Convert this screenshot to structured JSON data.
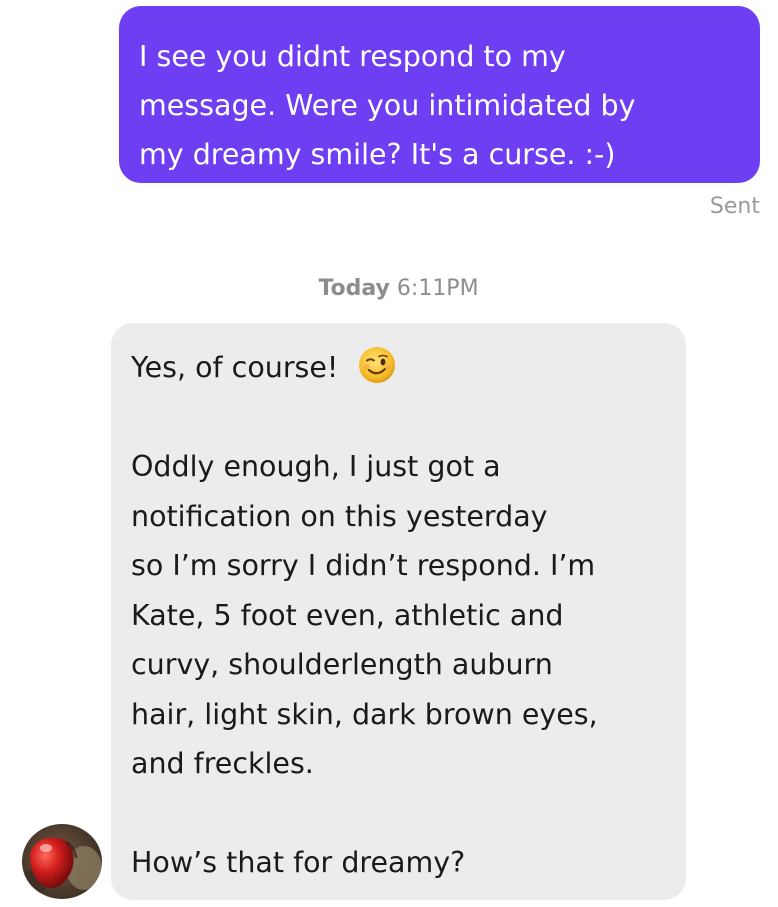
{
  "outgoing_message": {
    "lines": [
      "I see you didnt respond to my",
      "message. Were you intimidated by",
      "my dreamy smile?  It's a curse.  :-)"
    ],
    "status": "Sent"
  },
  "timestamp": {
    "day": "Today",
    "time": "6:11PM"
  },
  "incoming_message": {
    "greeting": "Yes, of course!",
    "emoji": "winking-face-icon",
    "body_lines": [
      "Oddly enough, I just got a",
      "notification on this yesterday",
      "so I’m sorry I didn’t respond. I’m",
      "Kate, 5 foot even, athletic and",
      "curvy, shoulderlength auburn",
      "hair, light skin, dark brown eyes,",
      "and freckles."
    ],
    "closing": "How’s that for dreamy?"
  },
  "colors": {
    "outgoing_bubble": "#6e3ef2",
    "incoming_bubble": "#ececec",
    "muted_text": "#9a9a9a"
  }
}
